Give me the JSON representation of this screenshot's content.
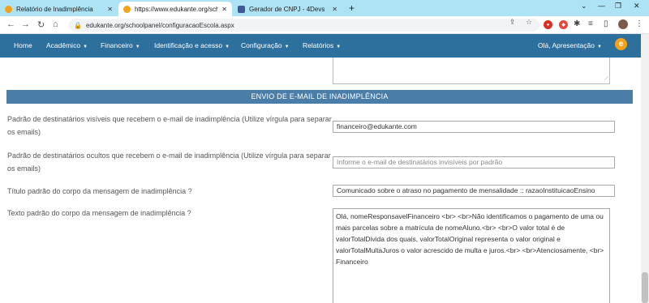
{
  "browser": {
    "tabs": [
      {
        "label": "Relatório de Inadimplência",
        "icon": "edukante-favicon"
      },
      {
        "label": "https://www.edukante.org/schoo…",
        "icon": "edukante-favicon"
      },
      {
        "label": "Gerador de CNPJ - 4Devs",
        "icon": "page-favicon"
      }
    ],
    "url": "edukante.org/schoolpanel/configuracaoEscola.aspx"
  },
  "navbar": {
    "items": [
      "Home",
      "Acadêmico",
      "Financeiro",
      "Identificação e acesso",
      "Configuração",
      "Relatórios"
    ],
    "user_greeting": "Olá, Apresentação",
    "logo_letter": "e"
  },
  "section": {
    "title": "ENVIO DE E-MAIL DE INADIMPLÊNCIA"
  },
  "fields": {
    "visible_recipients": {
      "label": "Padrão de destinatários visíveis que recebem o e-mail de inadimplência (Utilize vírgula para separar os emails)",
      "value": "financeiro@edukante.com"
    },
    "hidden_recipients": {
      "label": "Padrão de destinatários ocultos que recebem o e-mail de inadimplência (Utilize vírgula para separar os emails)",
      "placeholder": "Informe o e-mail de destinatários invisíveis por padrão"
    },
    "subject": {
      "label": "Título padrão do corpo da mensagem de inadimplência ?",
      "value": "Comunicado sobre o atraso no pagamento de mensalidade :: razaoInstituicaoEnsino"
    },
    "body": {
      "label": "Texto padrão do corpo da mensagem de inadimplência ?",
      "value": "Olá, nomeResponsavelFinanceiro  <br>  <br>Não identificamos o pagamento  de uma ou mais parcelas sobre a matrícula de nomeAluno.<br>  <br>O valor total é de valorTotalDivida  dos quais, valorTotalOriginal  representa o valor original e valorTotalMultaJuros  o valor acrescido de multa e juros.<br>  <br>Atenciosamente, <br>  Financeiro"
    }
  },
  "colors": {
    "navbar": "#2d6f9d",
    "section_header": "#4a7ea8",
    "tabstrip": "#aee3f5",
    "brand": "#f5a21b"
  }
}
